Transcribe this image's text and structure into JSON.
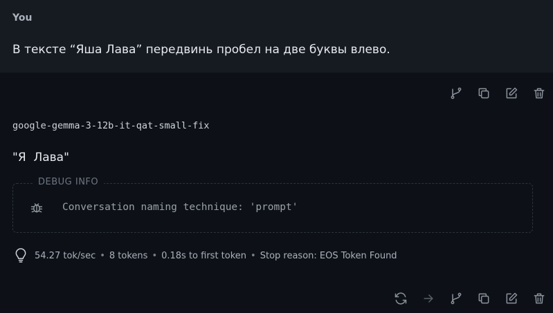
{
  "user": {
    "name": "You",
    "message": "В тексте “Яша Лава” передвинь пробел на две буквы влево."
  },
  "assistant": {
    "model": "google-gemma-3-12b-it-qat-small-fix",
    "answer": "\"Я  Лава\"",
    "debug": {
      "legend": "DEBUG INFO",
      "text": "Conversation naming technique: 'prompt'"
    },
    "stats": {
      "speed": "54.27 tok/sec",
      "tokens": "8 tokens",
      "first_token": "0.18s to first token",
      "stop_reason": "Stop reason: EOS Token Found",
      "separator": "•"
    }
  },
  "icons": {
    "top": [
      "branch-icon",
      "copy-icon",
      "edit-icon",
      "trash-icon"
    ],
    "bottom": [
      "regenerate-icon",
      "continue-arrow-icon",
      "branch-icon",
      "copy-icon",
      "edit-icon",
      "trash-icon"
    ]
  },
  "colors": {
    "background": "#0d1117",
    "user_block": "#161b22",
    "icon": "#8b929c"
  }
}
